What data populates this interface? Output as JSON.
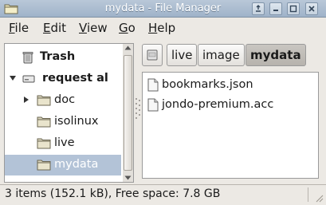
{
  "window": {
    "title": "mydata - File Manager",
    "controls": [
      "pin-icon",
      "minimize-icon",
      "maximize-icon",
      "close-icon"
    ]
  },
  "menu": {
    "file_pre": "",
    "file_ul": "F",
    "file_post": "ile",
    "edit_pre": "",
    "edit_ul": "E",
    "edit_post": "dit",
    "view_pre": "",
    "view_ul": "V",
    "view_post": "iew",
    "go_pre": "",
    "go_ul": "G",
    "go_post": "o",
    "help_pre": "",
    "help_ul": "H",
    "help_post": "elp"
  },
  "sidebar": {
    "items": [
      {
        "label": "Trash",
        "icon": "trash-icon",
        "bold": true
      },
      {
        "label": "request al",
        "icon": "drive-icon",
        "bold": true,
        "expanded": true
      },
      {
        "label": "doc",
        "icon": "folder-icon",
        "collapsed": true
      },
      {
        "label": "isolinux",
        "icon": "folder-icon"
      },
      {
        "label": "live",
        "icon": "folder-icon"
      },
      {
        "label": "mydata",
        "icon": "folder-icon",
        "selected": true
      }
    ]
  },
  "pathbar": {
    "buttons": [
      {
        "label": "",
        "icon": "drive-icon"
      },
      {
        "label": "live"
      },
      {
        "label": "image"
      },
      {
        "label": "mydata",
        "active": true
      }
    ]
  },
  "files": [
    {
      "name": "bookmarks.json",
      "icon": "document-icon"
    },
    {
      "name": "jondo-premium.acc",
      "icon": "document-icon"
    }
  ],
  "status": {
    "text": "3 items (152.1 kB), Free space: 7.8 GB"
  },
  "colors": {
    "titlebar": "#9fb3c9",
    "selection": "#b3c3d7",
    "window_bg": "#ece9e4"
  }
}
